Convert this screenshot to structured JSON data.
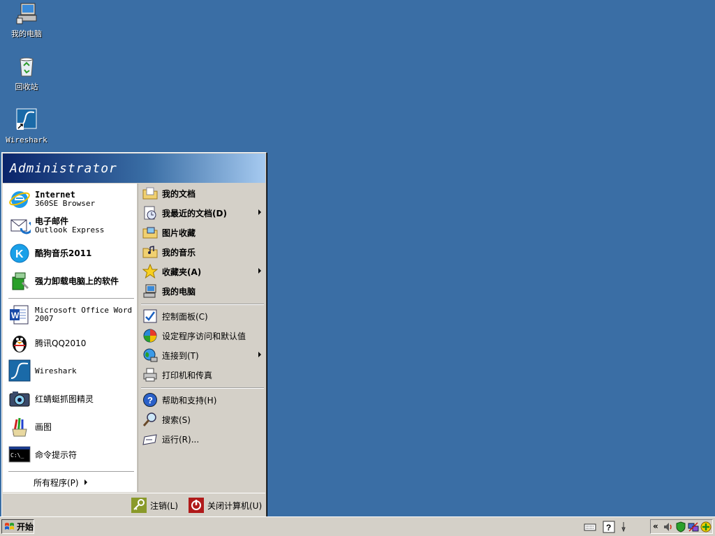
{
  "desktop": {
    "icons": [
      {
        "label": "我的电脑",
        "icon": "computer-icon"
      },
      {
        "label": "回收站",
        "icon": "recycle-bin-icon"
      },
      {
        "label": "Wireshark",
        "icon": "wireshark-icon"
      }
    ]
  },
  "start_menu": {
    "user": "Administrator",
    "pinned": [
      {
        "title": "Internet",
        "subtitle": "360SE Browser",
        "icon": "ie-browser-icon"
      },
      {
        "title": "电子邮件",
        "subtitle": "Outlook Express",
        "icon": "outlook-express-icon"
      },
      {
        "title": "酷狗音乐2011",
        "icon": "kugou-music-icon"
      },
      {
        "title": "强力卸载电脑上的软件",
        "icon": "uninstaller-icon"
      }
    ],
    "recent": [
      {
        "title": "Microsoft Office Word 2007",
        "icon": "word-icon"
      },
      {
        "title": "腾讯QQ2010",
        "icon": "qq-penguin-icon"
      },
      {
        "title": "Wireshark",
        "icon": "wireshark-icon"
      },
      {
        "title": "红蜻蜓抓图精灵",
        "icon": "camera-icon"
      },
      {
        "title": "画图",
        "icon": "paint-icon"
      },
      {
        "title": "命令提示符",
        "icon": "command-prompt-icon"
      }
    ],
    "all_programs": "所有程序(P)",
    "right": [
      {
        "label": "我的文档",
        "bold": true,
        "icon": "documents-folder-icon"
      },
      {
        "label": "我最近的文档(D)",
        "bold": true,
        "submenu": true,
        "icon": "recent-documents-icon"
      },
      {
        "label": "图片收藏",
        "bold": true,
        "icon": "pictures-folder-icon"
      },
      {
        "label": "我的音乐",
        "bold": true,
        "icon": "music-folder-icon"
      },
      {
        "label": "收藏夹(A)",
        "bold": true,
        "submenu": true,
        "icon": "favorites-star-icon"
      },
      {
        "label": "我的电脑",
        "bold": true,
        "icon": "computer-icon"
      },
      {
        "label": "控制面板(C)",
        "icon": "control-panel-icon"
      },
      {
        "label": "设定程序访问和默认值",
        "icon": "program-defaults-icon"
      },
      {
        "label": "连接到(T)",
        "submenu": true,
        "icon": "connect-globe-icon"
      },
      {
        "label": "打印机和传真",
        "icon": "printer-icon"
      },
      {
        "label": "帮助和支持(H)",
        "icon": "help-icon"
      },
      {
        "label": "搜索(S)",
        "icon": "search-icon"
      },
      {
        "label": "运行(R)...",
        "icon": "run-icon"
      }
    ],
    "logoff": "注销(L)",
    "shutdown": "关闭计算机(U)"
  },
  "taskbar": {
    "start_label": "开始",
    "tray_icons": [
      "keyboard-icon",
      "help-tray-icon",
      "pen-tray-icon",
      "show-hidden-icons-icon",
      "volume-icon",
      "shield-icon",
      "network-icon",
      "update-icon"
    ]
  },
  "colors": {
    "desktop": "#3a6ea5",
    "menu_face": "#d4d0c8",
    "header_start": "#0a246a",
    "header_end": "#a6caf0"
  }
}
